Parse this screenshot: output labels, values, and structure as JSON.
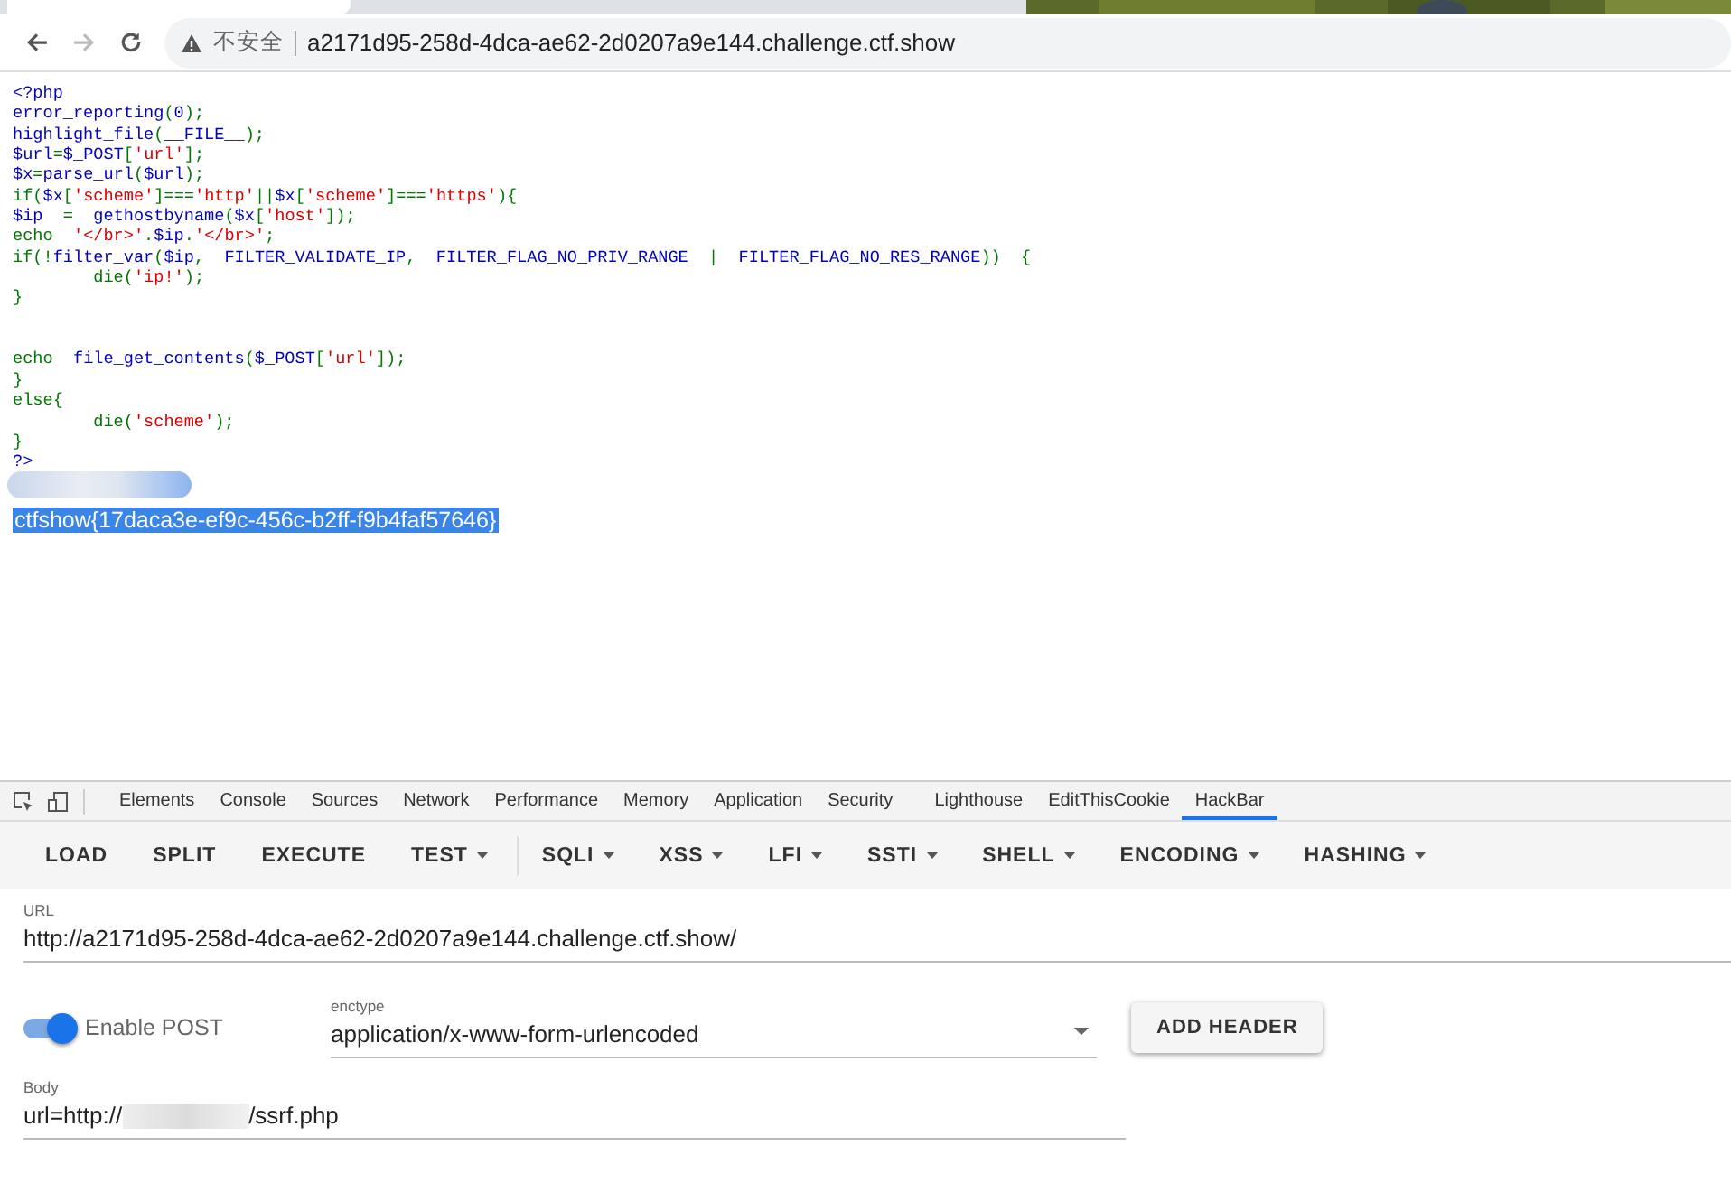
{
  "browser": {
    "insecure_label": "不安全",
    "address": "a2171d95-258d-4dca-ae62-2d0207a9e144.challenge.ctf.show"
  },
  "code_lines": [
    [
      {
        "kind": "default",
        "t": "<?php"
      }
    ],
    [
      {
        "kind": "default",
        "t": "error_reporting"
      },
      {
        "kind": "keyword",
        "t": "("
      },
      {
        "kind": "default",
        "t": "0"
      },
      {
        "kind": "keyword",
        "t": ");"
      }
    ],
    [
      {
        "kind": "default",
        "t": "highlight_file"
      },
      {
        "kind": "keyword",
        "t": "("
      },
      {
        "kind": "default",
        "t": "__FILE__"
      },
      {
        "kind": "keyword",
        "t": ");"
      }
    ],
    [
      {
        "kind": "default",
        "t": "$url"
      },
      {
        "kind": "keyword",
        "t": "="
      },
      {
        "kind": "default",
        "t": "$_POST"
      },
      {
        "kind": "keyword",
        "t": "["
      },
      {
        "kind": "string",
        "t": "'url'"
      },
      {
        "kind": "keyword",
        "t": "];"
      }
    ],
    [
      {
        "kind": "default",
        "t": "$x"
      },
      {
        "kind": "keyword",
        "t": "="
      },
      {
        "kind": "default",
        "t": "parse_url"
      },
      {
        "kind": "keyword",
        "t": "("
      },
      {
        "kind": "default",
        "t": "$url"
      },
      {
        "kind": "keyword",
        "t": ");"
      }
    ],
    [
      {
        "kind": "keyword",
        "t": "if("
      },
      {
        "kind": "default",
        "t": "$x"
      },
      {
        "kind": "keyword",
        "t": "["
      },
      {
        "kind": "string",
        "t": "'scheme'"
      },
      {
        "kind": "keyword",
        "t": "]==="
      },
      {
        "kind": "string",
        "t": "'http'"
      },
      {
        "kind": "keyword",
        "t": "||"
      },
      {
        "kind": "default",
        "t": "$x"
      },
      {
        "kind": "keyword",
        "t": "["
      },
      {
        "kind": "string",
        "t": "'scheme'"
      },
      {
        "kind": "keyword",
        "t": "]==="
      },
      {
        "kind": "string",
        "t": "'https'"
      },
      {
        "kind": "keyword",
        "t": "){"
      }
    ],
    [
      {
        "kind": "default",
        "t": "$ip  "
      },
      {
        "kind": "keyword",
        "t": "=  "
      },
      {
        "kind": "default",
        "t": "gethostbyname"
      },
      {
        "kind": "keyword",
        "t": "("
      },
      {
        "kind": "default",
        "t": "$x"
      },
      {
        "kind": "keyword",
        "t": "["
      },
      {
        "kind": "string",
        "t": "'host'"
      },
      {
        "kind": "keyword",
        "t": "]);"
      }
    ],
    [
      {
        "kind": "keyword",
        "t": "echo  "
      },
      {
        "kind": "string",
        "t": "'</br>'"
      },
      {
        "kind": "keyword",
        "t": "."
      },
      {
        "kind": "default",
        "t": "$ip"
      },
      {
        "kind": "keyword",
        "t": "."
      },
      {
        "kind": "string",
        "t": "'</br>'"
      },
      {
        "kind": "keyword",
        "t": ";"
      }
    ],
    [
      {
        "kind": "keyword",
        "t": "if(!"
      },
      {
        "kind": "default",
        "t": "filter_var"
      },
      {
        "kind": "keyword",
        "t": "("
      },
      {
        "kind": "default",
        "t": "$ip"
      },
      {
        "kind": "keyword",
        "t": ",  "
      },
      {
        "kind": "default",
        "t": "FILTER_VALIDATE_IP"
      },
      {
        "kind": "keyword",
        "t": ",  "
      },
      {
        "kind": "default",
        "t": "FILTER_FLAG_NO_PRIV_RANGE  "
      },
      {
        "kind": "keyword",
        "t": "|  "
      },
      {
        "kind": "default",
        "t": "FILTER_FLAG_NO_RES_RANGE"
      },
      {
        "kind": "keyword",
        "t": "))  {"
      }
    ],
    [
      {
        "kind": "keyword",
        "t": "        die("
      },
      {
        "kind": "string",
        "t": "'ip!'"
      },
      {
        "kind": "keyword",
        "t": ");"
      }
    ],
    [
      {
        "kind": "keyword",
        "t": "}"
      }
    ],
    [
      {
        "kind": "blank"
      }
    ],
    [
      {
        "kind": "blank"
      }
    ],
    [
      {
        "kind": "keyword",
        "t": "echo  "
      },
      {
        "kind": "default",
        "t": "file_get_contents"
      },
      {
        "kind": "keyword",
        "t": "("
      },
      {
        "kind": "default",
        "t": "$_POST"
      },
      {
        "kind": "keyword",
        "t": "["
      },
      {
        "kind": "string",
        "t": "'url'"
      },
      {
        "kind": "keyword",
        "t": "]);"
      }
    ],
    [
      {
        "kind": "keyword",
        "t": "}"
      }
    ],
    [
      {
        "kind": "keyword",
        "t": "else{"
      }
    ],
    [
      {
        "kind": "keyword",
        "t": "        die("
      },
      {
        "kind": "string",
        "t": "'scheme'"
      },
      {
        "kind": "keyword",
        "t": ");"
      }
    ],
    [
      {
        "kind": "keyword",
        "t": "}"
      }
    ],
    [
      {
        "kind": "default",
        "t": "?>"
      }
    ]
  ],
  "output": {
    "text": "ctfshow{17daca3e-ef9c-456c-b2ff-f9b4faf57646}",
    "selected": true
  },
  "devtools_tabs": [
    {
      "label": "Elements",
      "selected": false
    },
    {
      "label": "Console",
      "selected": false
    },
    {
      "label": "Sources",
      "selected": false
    },
    {
      "label": "Network",
      "selected": false
    },
    {
      "label": "Performance",
      "selected": false
    },
    {
      "label": "Memory",
      "selected": false
    },
    {
      "label": "Application",
      "selected": false
    },
    {
      "label": "Security",
      "selected": false
    },
    {
      "label": "Lighthouse",
      "selected": false
    },
    {
      "label": "EditThisCookie",
      "selected": false
    },
    {
      "label": "HackBar",
      "selected": true
    }
  ],
  "hackbar_buttons": [
    {
      "label": "LOAD",
      "has_menu": false
    },
    {
      "label": "SPLIT",
      "has_menu": false
    },
    {
      "label": "EXECUTE",
      "has_menu": false
    },
    {
      "label": "TEST",
      "has_menu": true
    },
    {
      "label": "SQLI",
      "has_menu": true
    },
    {
      "label": "XSS",
      "has_menu": true
    },
    {
      "label": "LFI",
      "has_menu": true
    },
    {
      "label": "SSTI",
      "has_menu": true
    },
    {
      "label": "SHELL",
      "has_menu": true
    },
    {
      "label": "ENCODING",
      "has_menu": true
    },
    {
      "label": "HASHING",
      "has_menu": true
    }
  ],
  "url_field": {
    "label": "URL",
    "value": "http://a2171d95-258d-4dca-ae62-2d0207a9e144.challenge.ctf.show/"
  },
  "enable_post": {
    "label": "Enable POST",
    "on": true
  },
  "enctype": {
    "label": "enctype",
    "value": "application/x-www-form-urlencoded"
  },
  "add_header_button": "ADD HEADER",
  "body_field": {
    "label": "Body",
    "value_before": "url=http://",
    "value_after": "/ssrf.php"
  }
}
